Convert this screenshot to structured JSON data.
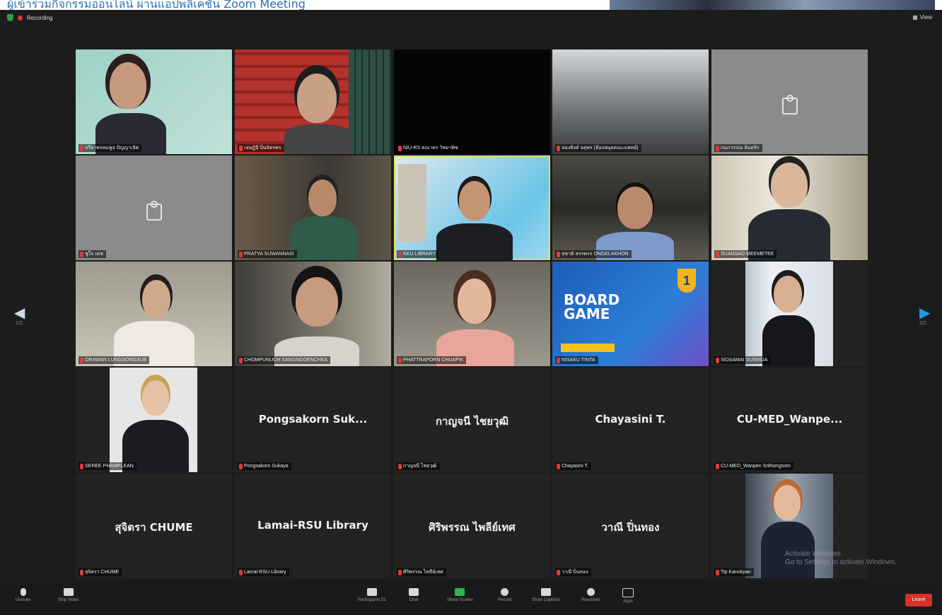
{
  "banner": {
    "text": "ผู้เข้าร่วมกิจกรรมออนไลน์ ผ่านแอปพลิเคชัน Zoom Meeting"
  },
  "topbar": {
    "recording": "Recording",
    "view": "View"
  },
  "participants": [
    {
      "label": "ปรียาพรหมพูล ปัญญาเลิศ",
      "kind": "video"
    },
    {
      "label": "เจษฎ์นี ปิ่นจิตรพร",
      "kind": "video"
    },
    {
      "label": "NIU-RS คณาทร วิชยาพิช",
      "kind": "video"
    },
    {
      "label": "ทองสิงค์ จตุพร (ห้องสมุดคณะแพทย์)",
      "kind": "video"
    },
    {
      "label": "กนกวรรณ จันทรัก",
      "kind": "placeholder"
    },
    {
      "label": "ชูใจ เดช",
      "kind": "placeholder"
    },
    {
      "label": "PRATYA SUWANNASI",
      "kind": "video"
    },
    {
      "label": "KKU LIBRARY",
      "kind": "video"
    },
    {
      "label": "สุชาติ สรรพรร ONGKLAKHON",
      "kind": "video"
    },
    {
      "label": "SUANSAO MEEMETEE",
      "kind": "video"
    },
    {
      "label": "ORAWAN LUNGSONGSUE",
      "kind": "video"
    },
    {
      "label": "CHOMPUNUCH SANGNGOENCHEA",
      "kind": "video"
    },
    {
      "label": "PHATTRAPORN CHUAPIK",
      "kind": "video"
    },
    {
      "label": "NISAKU TINTA",
      "kind": "boardgame"
    },
    {
      "label": "SIDSAMAI SUSINDA",
      "kind": "video"
    },
    {
      "label": "SEREE PHAMPLEAN",
      "kind": "video"
    },
    {
      "label": "Pongsakorn Sukaya",
      "kind": "name",
      "big": "Pongsakorn  Suk..."
    },
    {
      "label": "กาญจนี ไชยวุฒิ",
      "kind": "name",
      "big": "กาญจนี  ไชยวุฒิ"
    },
    {
      "label": "Chayasini T.",
      "kind": "name",
      "big": "Chayasini T."
    },
    {
      "label": "CU-MED_Wanpen Srithongsom",
      "kind": "name",
      "big": "CU-MED_Wanpe..."
    },
    {
      "label": "สุจิตรา CHUME",
      "kind": "name",
      "big": "สุจิตรา  CHUME"
    },
    {
      "label": "Lamai-RSU Library",
      "kind": "name",
      "big": "Lamai-RSU Library"
    },
    {
      "label": "ศิริพรรณ ไพลีย์เทศ",
      "kind": "name",
      "big": "ศิริพรรณ  ไพลีย์เทศ"
    },
    {
      "label": "วาณี ปิ่นทอง",
      "kind": "name",
      "big": "วาณี  ปิ่นทอง"
    },
    {
      "label": "Tip Kanokpan",
      "kind": "video"
    }
  ],
  "boardgame": {
    "line1": "BOARD",
    "line2": "GAME",
    "badge": "1"
  },
  "navigation": {
    "prev": "1/2",
    "next": "2/2"
  },
  "toolbar": {
    "unmute": "Unmute",
    "video": "Stop Video",
    "participants": "Participants",
    "participants_count": "51",
    "chat": "Chat",
    "share": "Share Screen",
    "record": "Record",
    "captions": "Show Captions",
    "reactions": "Reactions",
    "apps": "Apps",
    "leave": "Leave"
  },
  "watermark": {
    "line1": "Activate Windows",
    "line2": "Go to Settings to activate Windows."
  }
}
